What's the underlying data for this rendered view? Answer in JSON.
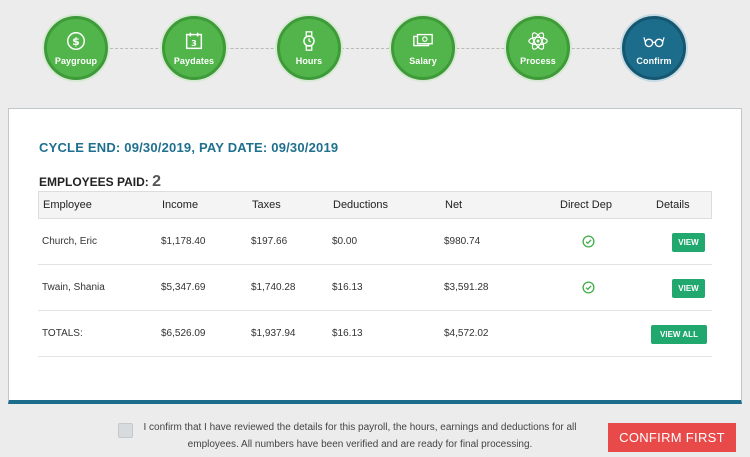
{
  "stepper": {
    "steps": [
      {
        "label": "Paygroup",
        "icon": "dollar-coin-icon"
      },
      {
        "label": "Paydates",
        "icon": "calendar-icon"
      },
      {
        "label": "Hours",
        "icon": "watch-icon"
      },
      {
        "label": "Salary",
        "icon": "cash-icon"
      },
      {
        "label": "Process",
        "icon": "atom-icon"
      },
      {
        "label": "Confirm",
        "icon": "glasses-icon"
      }
    ],
    "active_index": 5,
    "colors": {
      "complete": "#52b54b",
      "active": "#1c6c8c"
    }
  },
  "summary": {
    "cycle_text": "CYCLE END: 09/30/2019, PAY DATE: 09/30/2019",
    "paid_label": "EMPLOYEES PAID:",
    "paid_count": "2"
  },
  "table": {
    "headers": {
      "employee": "Employee",
      "income": "Income",
      "taxes": "Taxes",
      "deductions": "Deductions",
      "net": "Net",
      "direct_dep": "Direct Dep",
      "details": "Details"
    },
    "rows": [
      {
        "employee": "Church, Eric",
        "income": "$1,178.40",
        "taxes": "$197.66",
        "deductions": "$0.00",
        "net": "$980.74",
        "direct_dep": true,
        "details_label": "VIEW"
      },
      {
        "employee": "Twain, Shania",
        "income": "$5,347.69",
        "taxes": "$1,740.28",
        "deductions": "$16.13",
        "net": "$3,591.28",
        "direct_dep": true,
        "details_label": "VIEW"
      }
    ],
    "totals": {
      "label": "TOTALS:",
      "income": "$6,526.09",
      "taxes": "$1,937.94",
      "deductions": "$16.13",
      "net": "$4,572.02",
      "details_label": "VIEW ALL"
    }
  },
  "footer": {
    "confirm_text": "I confirm that I have reviewed the details for this payroll, the hours, earnings and deductions for all employees. All numbers have been verified and are ready for final processing.",
    "confirm_checked": false,
    "confirm_button": "CONFIRM FIRST"
  },
  "colors": {
    "accent": "#1c6c8c",
    "view_button": "#20a86f",
    "confirm_button": "#e84a4a"
  }
}
